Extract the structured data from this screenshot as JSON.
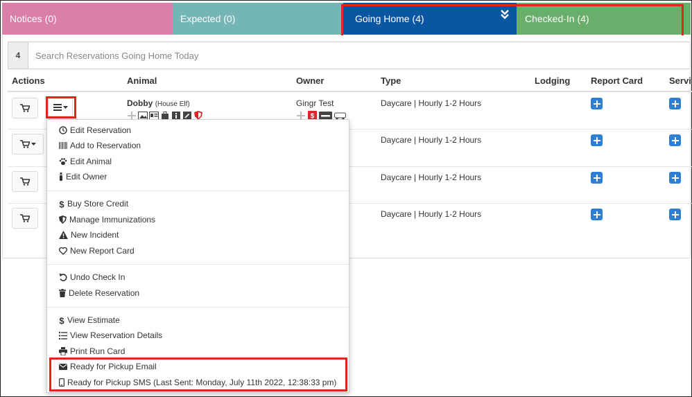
{
  "tabs": [
    {
      "label": "Notices (0)"
    },
    {
      "label": "Expected (0)"
    },
    {
      "label": "Going Home (4)"
    },
    {
      "label": "Checked-In (4)"
    }
  ],
  "search": {
    "count": "4",
    "placeholder": "Search Reservations Going Home Today"
  },
  "table": {
    "headers": [
      "Actions",
      "Animal",
      "Owner",
      "Type",
      "Lodging",
      "Report Card",
      "Servic"
    ],
    "rows": [
      {
        "animal": "Dobby",
        "breed": "(House Elf)",
        "owner": "Gingr Test",
        "type": "Daycare | Hourly 1-2 Hours"
      },
      {
        "type": "Daycare | Hourly 1-2 Hours"
      },
      {
        "type": "Daycare | Hourly 1-2 Hours"
      },
      {
        "type": "Daycare | Hourly 1-2 Hours"
      }
    ]
  },
  "menu": {
    "groups": [
      [
        {
          "icon": "clock-icon",
          "label": "Edit Reservation"
        },
        {
          "icon": "barcode-icon",
          "label": "Add to Reservation"
        },
        {
          "icon": "paw-icon",
          "label": "Edit Animal"
        },
        {
          "icon": "person-icon",
          "label": "Edit Owner"
        }
      ],
      [
        {
          "icon": "dollar-icon",
          "label": "Buy Store Credit"
        },
        {
          "icon": "shield-icon",
          "label": "Manage Immunizations"
        },
        {
          "icon": "warning-icon",
          "label": "New Incident"
        },
        {
          "icon": "heart-icon",
          "label": "New Report Card"
        }
      ],
      [
        {
          "icon": "undo-icon",
          "label": "Undo Check In"
        },
        {
          "icon": "trash-icon",
          "label": "Delete Reservation"
        }
      ],
      [
        {
          "icon": "dollar-icon",
          "label": "View Estimate"
        },
        {
          "icon": "list-icon",
          "label": "View Reservation Details"
        },
        {
          "icon": "print-icon",
          "label": "Print Run Card"
        },
        {
          "icon": "envelope-icon",
          "label": "Ready for Pickup Email"
        },
        {
          "icon": "mobile-icon",
          "label": "Ready for Pickup SMS (Last Sent: Monday, July 11th 2022, 12:38:33 pm)"
        }
      ]
    ]
  },
  "colors": {
    "notices": "#d97fa9",
    "expected": "#74b5b6",
    "going_home": "#0b56a3",
    "checked_in": "#69ae6a",
    "highlight": "#e3241b",
    "plus_button": "#2e7fd4"
  }
}
